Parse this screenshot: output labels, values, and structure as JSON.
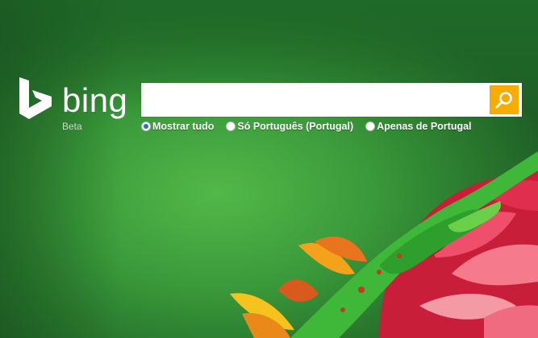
{
  "logo": {
    "word": "bing",
    "tag": "Beta",
    "icon": "bing-b-icon"
  },
  "search": {
    "value": "",
    "placeholder": "",
    "button_icon": "search-icon"
  },
  "options": [
    {
      "label": "Mostrar tudo",
      "checked": true
    },
    {
      "label": "Só Português (Portugal)",
      "checked": false
    },
    {
      "label": "Apenas de Portugal",
      "checked": false
    }
  ],
  "colors": {
    "accent": "#f7ad00",
    "background": "#3a9a3a"
  }
}
